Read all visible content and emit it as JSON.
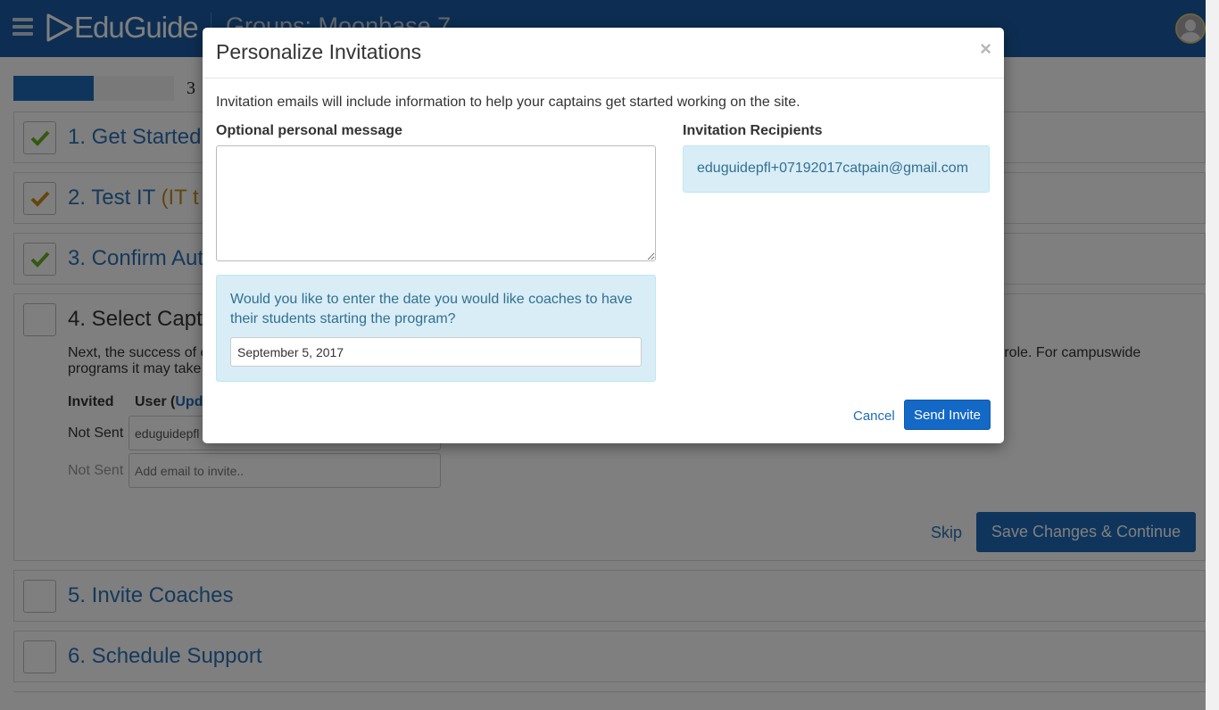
{
  "header": {
    "logo_text": "EduGuide",
    "group_title": "Groups: Moonbase 7"
  },
  "progress": {
    "value": 0.5,
    "text": "3"
  },
  "steps": [
    {
      "title": "1. Get Started",
      "checked": true,
      "check_color": "#6ab023"
    },
    {
      "title": "2. Test IT",
      "suffix": "(IT t",
      "checked": true,
      "check_color": "#c98d1b"
    },
    {
      "title": "3. Confirm Aut",
      "checked": true,
      "check_color": "#6ab023"
    },
    {
      "title": "4. Select Capt",
      "checked": false
    },
    {
      "title": "5. Invite Coaches",
      "checked": false
    },
    {
      "title": "6. Schedule Support",
      "checked": false
    }
  ],
  "step4": {
    "desc_start": "Next, the success of e",
    "desc_end": "p role. For campuswide",
    "desc_line2": "programs it may take",
    "col_invited": "Invited",
    "col_user": "User (",
    "col_user_link": "Upd",
    "rows": [
      {
        "status": "Not Sent",
        "email": "eduguidepfl"
      },
      {
        "status": "Not Sent",
        "placeholder": "Add email to invite.."
      }
    ],
    "skip_label": "Skip",
    "save_label": "Save Changes & Continue"
  },
  "modal": {
    "title": "Personalize Invitations",
    "close_glyph": "×",
    "intro": "Invitation emails will include information to help your captains get started working on the site.",
    "message_label": "Optional personal message",
    "message_value": "",
    "date_question": "Would you like to enter the date you would like coaches to have their students starting the program?",
    "date_value": "September 5, 2017",
    "recipients_label": "Invitation Recipients",
    "recipients": [
      "eduguidepfl+07192017catpain@gmail.com"
    ],
    "cancel_label": "Cancel",
    "send_label": "Send Invite"
  },
  "colors": {
    "brand_blue": "#1a5da4",
    "primary_button": "#1468c6",
    "info_panel": "#d9edf7",
    "info_text": "#31708f"
  }
}
